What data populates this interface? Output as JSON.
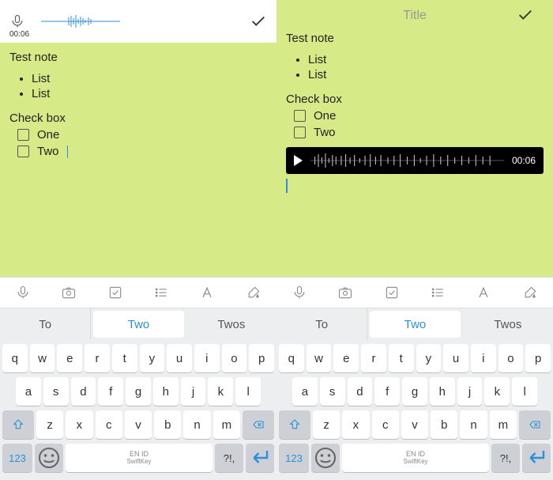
{
  "left": {
    "record_time": "00:06",
    "note_title": "Test note",
    "bullets": [
      "List",
      "List"
    ],
    "checkbox_heading": "Check box",
    "checks": [
      "One",
      "Two"
    ]
  },
  "right": {
    "title_placeholder": "Title",
    "note_title": "Test note",
    "bullets": [
      "List",
      "List"
    ],
    "checkbox_heading": "Check box",
    "checks": [
      "One",
      "Two"
    ],
    "audio_time": "00:06"
  },
  "suggestions": {
    "a": "To",
    "b": "Two",
    "c": "Twos"
  },
  "keyboard": {
    "row1": [
      "q",
      "w",
      "e",
      "r",
      "t",
      "y",
      "u",
      "i",
      "o",
      "p"
    ],
    "row2": [
      "a",
      "s",
      "d",
      "f",
      "g",
      "h",
      "j",
      "k",
      "l"
    ],
    "row3": [
      "z",
      "x",
      "c",
      "v",
      "b",
      "n",
      "m"
    ],
    "num": "123",
    "lang": "EN ID",
    "brand": "SwiftKey",
    "punct": "?!,"
  }
}
